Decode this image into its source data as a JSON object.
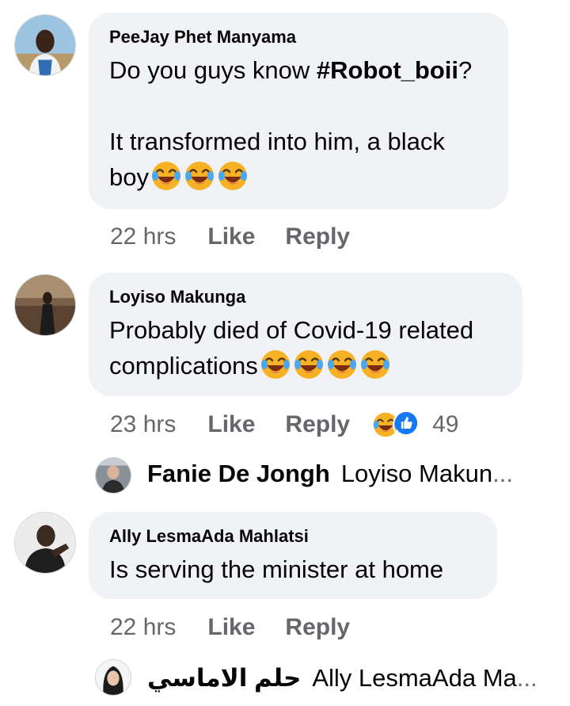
{
  "comments": [
    {
      "author": "PeeJay Phet Manyama",
      "text_line1_pre": "Do you guys know ",
      "hashtag": "#Robot_boii",
      "text_line1_post": "?",
      "text_line2": "It transformed into him, a black boy",
      "time": "22 hrs",
      "like_label": "Like",
      "reply_label": "Reply"
    },
    {
      "author": "Loyiso Makunga",
      "text": "Probably died of Covid-19 related complications",
      "time": "23 hrs",
      "like_label": "Like",
      "reply_label": "Reply",
      "reaction_count": "49",
      "reply_preview": {
        "author": "Fanie De Jongh",
        "text": "Loyiso Makun",
        "ellipsis": "..."
      }
    },
    {
      "author": "Ally LesmaAda Mahlatsi",
      "text": "Is serving the minister at home",
      "time": "22 hrs",
      "like_label": "Like",
      "reply_label": "Reply",
      "reply_preview": {
        "author": "حلم الاماسي",
        "text": "Ally LesmaAda Ma",
        "ellipsis": "..."
      }
    }
  ],
  "colors": {
    "bubble": "#f0f2f5",
    "meta_text": "#65676b",
    "like_blue": "#1877f2",
    "haha_yellow": "#f7b125"
  },
  "icons": [
    "haha-emoji-icon",
    "like-reaction-icon",
    "avatar"
  ]
}
